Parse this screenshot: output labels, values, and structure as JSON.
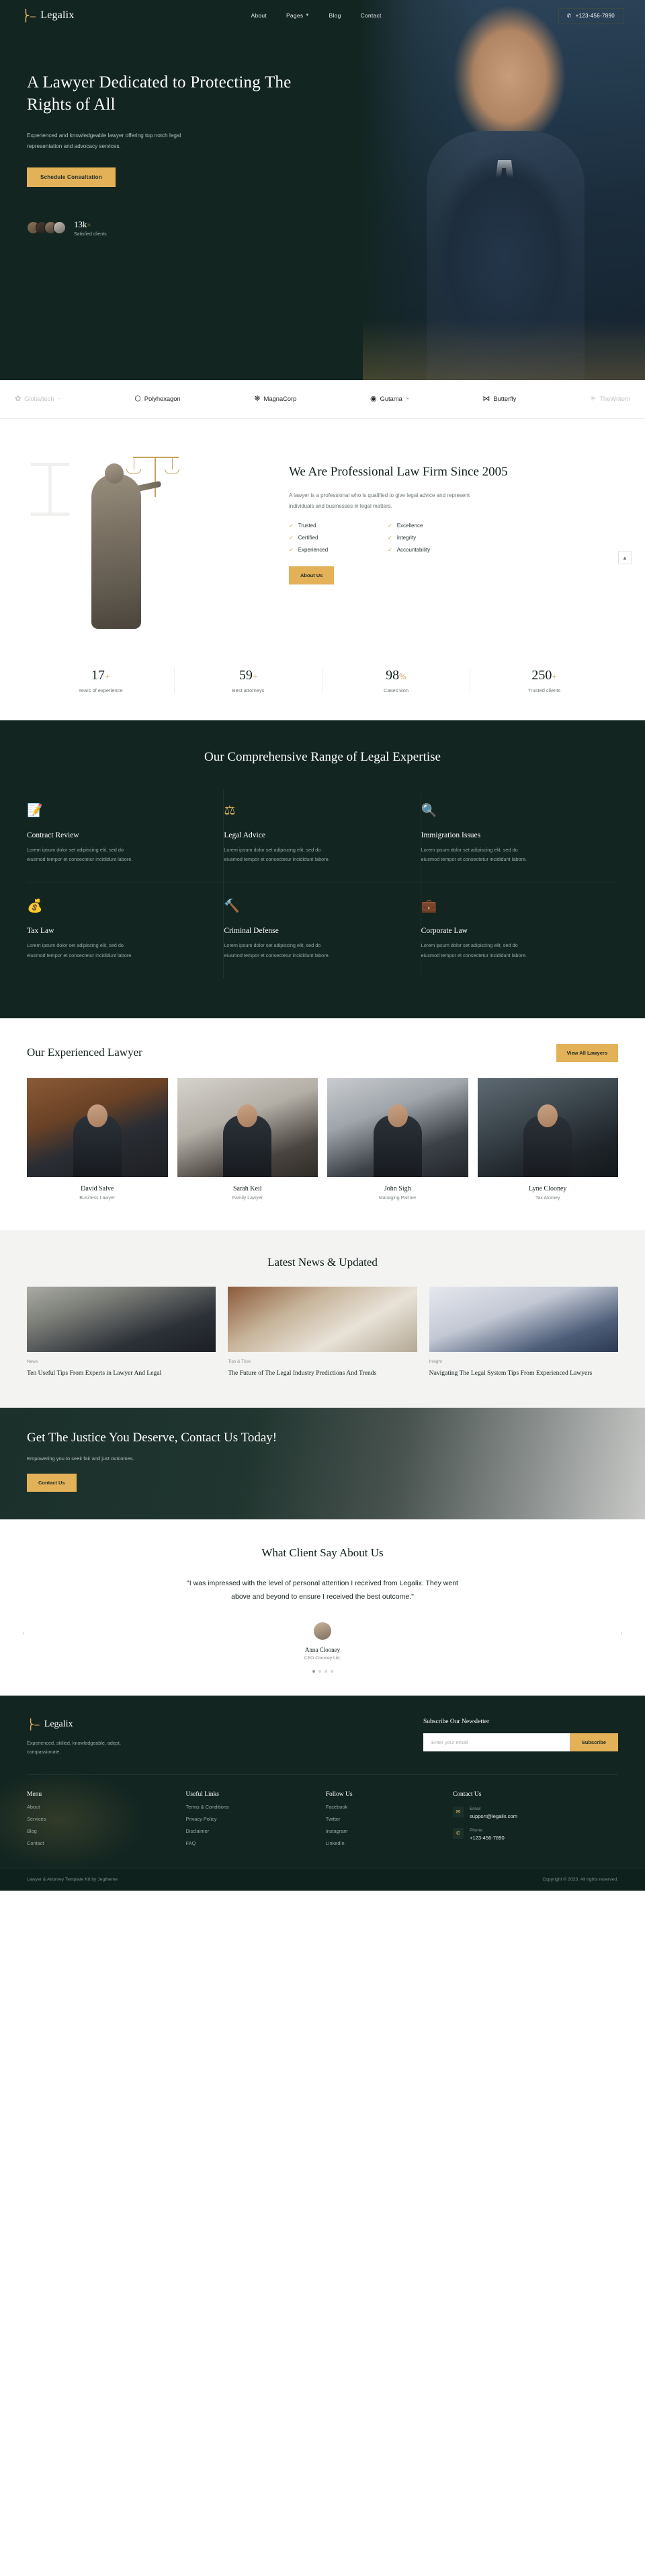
{
  "brand": {
    "name": "Legalix",
    "mark": "⌸"
  },
  "nav": {
    "links": [
      {
        "label": "About",
        "has_chevron": false
      },
      {
        "label": "Pages",
        "has_chevron": true
      },
      {
        "label": "Blog",
        "has_chevron": false
      },
      {
        "label": "Contact",
        "has_chevron": false
      }
    ],
    "phone": "+123-456-7890",
    "phone_icon": "phone-icon"
  },
  "hero": {
    "title": "A Lawyer Dedicated to Protecting The Rights of All",
    "subtitle": "Experienced and knowledgeable lawyer offering top notch legal representation and advocacy services.",
    "cta": "Schedule Consultation",
    "clients_count": "13k",
    "clients_plus": "+",
    "clients_label": "Satisfied clients"
  },
  "logos": [
    {
      "name": "Globaltech",
      "glyph": "✿",
      "tm": "™",
      "faded": true
    },
    {
      "name": "Polyhexagon",
      "glyph": "⬡",
      "tm": "",
      "faded": false
    },
    {
      "name": "MagnaCorp",
      "glyph": "❋",
      "tm": "",
      "faded": false
    },
    {
      "name": "Gutama",
      "glyph": "◉",
      "tm": "™",
      "faded": false
    },
    {
      "name": "Butterfly",
      "glyph": "⋈",
      "tm": "",
      "faded": false
    },
    {
      "name": "TheWritern",
      "glyph": "✳",
      "tm": "",
      "faded": true
    }
  ],
  "about": {
    "watermark": "⌶",
    "title": "We Are Professional Law Firm Since 2005",
    "description": "A lawyer is a professional who is qualified to give legal advice and represent individuals and businesses in legal matters.",
    "features": [
      "Trusted",
      "Excellence",
      "Certified",
      "Integrity",
      "Experienced",
      "Accountability"
    ],
    "cta": "About Us",
    "scroll_top_icon": "arrow-up-icon"
  },
  "stats": [
    {
      "value": "17",
      "suffix": "+",
      "label": "Years of experience"
    },
    {
      "value": "59",
      "suffix": "+",
      "label": "Best attorneys"
    },
    {
      "value": "98",
      "suffix": "%",
      "label": "Cases won"
    },
    {
      "value": "250",
      "suffix": "+",
      "label": "Trusted clients"
    }
  ],
  "services": {
    "title": "Our Comprehensive Range of Legal Expertise",
    "items": [
      {
        "icon": "📝",
        "icon_name": "contract-document-icon",
        "name": "Contract Review",
        "desc": "Lorem ipsum dolor set adipiscing elit, sed do eiusmod tempor et consectetur incididunt labore."
      },
      {
        "icon": "⚖",
        "icon_name": "scales-of-justice-icon",
        "name": "Legal Advice",
        "desc": "Lorem ipsum dolor set adipiscing elit, sed do eiusmod tempor et consectetur incididunt labore."
      },
      {
        "icon": "🔍",
        "icon_name": "document-search-icon",
        "name": "Immigration Issues",
        "desc": "Lorem ipsum dolor set adipiscing elit, sed do eiusmod tempor et consectetur incididunt labore."
      },
      {
        "icon": "💰",
        "icon_name": "money-bag-icon",
        "name": "Tax Law",
        "desc": "Lorem ipsum dolor set adipiscing elit, sed do eiusmod tempor et consectetur incididunt labore."
      },
      {
        "icon": "🔨",
        "icon_name": "gavel-icon",
        "name": "Criminal Defense",
        "desc": "Lorem ipsum dolor set adipiscing elit, sed do eiusmod tempor et consectetur incididunt labore."
      },
      {
        "icon": "💼",
        "icon_name": "briefcase-icon",
        "name": "Corporate Law",
        "desc": "Lorem ipsum dolor set adipiscing elit, sed do eiusmod tempor et consectetur incididunt labore."
      }
    ]
  },
  "lawyers": {
    "title": "Our Experienced Lawyer",
    "cta": "View All Lawyers",
    "items": [
      {
        "name": "David Salve",
        "role": "Business Lawyer"
      },
      {
        "name": "Sarah Keil",
        "role": "Family Lawyer"
      },
      {
        "name": "John Sigh",
        "role": "Managing Partner"
      },
      {
        "name": "Lyne Clooney",
        "role": "Tax Atorney"
      }
    ]
  },
  "news": {
    "title": "Latest News & Updated",
    "items": [
      {
        "category": "News",
        "headline": "Ten Useful Tips From Experts in Lawyer And Legal"
      },
      {
        "category": "Tips & Trick",
        "headline": "The Future of The Legal Industry Predictions And Trends"
      },
      {
        "category": "Insight",
        "headline": "Navigating The Legal System Tips From Experienced Lawyers"
      }
    ]
  },
  "cta": {
    "title": "Get The Justice You Deserve, Contact Us Today!",
    "subtitle": "Empowering you to seek fair and just outcomes.",
    "button": "Contact Us"
  },
  "testimonial": {
    "title": "What Client Say About Us",
    "quote": "\"I was impressed with the level of personal attention I received from Legalix. They went above and beyond to ensure I received the best outcome.\"",
    "name": "Anna Clooney",
    "role": "CEO Clooney Ltd.",
    "prev_icon": "chevron-left-icon",
    "next_icon": "chevron-right-icon",
    "dots": 4,
    "active_dot": 0
  },
  "footer": {
    "brand_name": "Legalix",
    "tagline": "Experienced, skilled, knowledgeable, adept, compassionate.",
    "newsletter_label": "Subscribe Our Newsletter",
    "newsletter_placeholder": "Enter your email",
    "newsletter_value": "",
    "newsletter_button": "Subscribe",
    "columns": [
      {
        "title": "Menu",
        "links": [
          "About",
          "Services",
          "Blog",
          "Contact"
        ]
      },
      {
        "title": "Useful Links",
        "links": [
          "Terms & Conditions",
          "Privacy Policy",
          "Disclaimer",
          "FAQ"
        ]
      },
      {
        "title": "Follow Us",
        "links": [
          "Facebook",
          "Twitter",
          "Instagram",
          "LinkedIn"
        ]
      }
    ],
    "contact": {
      "title": "Contact Us",
      "email_icon": "envelope-icon",
      "email_label": "Email",
      "email_value": "support@legalix.com",
      "phone_icon": "phone-icon",
      "phone_label": "Phone",
      "phone_value": "+123-456-7890"
    },
    "credit": "Lawyer & Attorney Template Kit by Jegtheme",
    "copyright": "Copyright © 2023. All rights reserved."
  },
  "colors": {
    "dark": "#122521",
    "gold": "#e3b158",
    "muted": "#9aa8a3"
  }
}
